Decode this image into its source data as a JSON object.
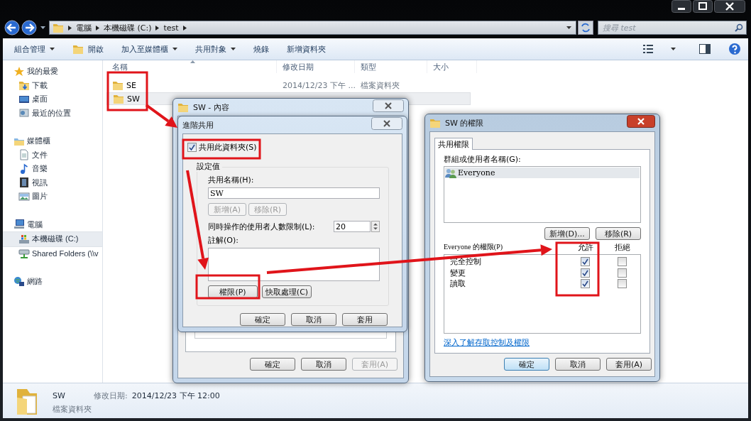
{
  "address_bar": {
    "path": [
      "電腦",
      "本機磁碟 (C:)",
      "test"
    ]
  },
  "search": {
    "placeholder": "搜尋 test"
  },
  "toolbar": [
    {
      "label": "組合管理",
      "kind": "menu"
    },
    {
      "label": "開啟",
      "kind": "open"
    },
    {
      "label": "加入至媒體櫃",
      "kind": "menu"
    },
    {
      "label": "共用對象",
      "kind": "menu"
    },
    {
      "label": "燒錄",
      "kind": "plain"
    },
    {
      "label": "新增資料夾",
      "kind": "plain"
    }
  ],
  "sidebar": [
    {
      "label": "我的最愛",
      "kind": "favorites",
      "selected": false,
      "children": [
        {
          "label": "下載",
          "kind": "download",
          "selected": false
        },
        {
          "label": "桌面",
          "kind": "desktop",
          "selected": false
        },
        {
          "label": "最近的位置",
          "kind": "recent",
          "selected": false
        }
      ]
    },
    {
      "label": "媒體櫃",
      "kind": "library",
      "selected": false,
      "children": [
        {
          "label": "文件",
          "kind": "document",
          "selected": false
        },
        {
          "label": "音樂",
          "kind": "music",
          "selected": false
        },
        {
          "label": "視訊",
          "kind": "video",
          "selected": false
        },
        {
          "label": "圖片",
          "kind": "picture",
          "selected": false
        }
      ]
    },
    {
      "label": "電腦",
      "kind": "computer",
      "selected": false,
      "children": [
        {
          "label": "本機磁碟 (C:)",
          "kind": "drive",
          "selected": true
        },
        {
          "label": "Shared Folders (\\\\v",
          "kind": "share",
          "selected": false
        }
      ]
    },
    {
      "label": "網路",
      "kind": "network",
      "selected": false
    }
  ],
  "file_list": {
    "columns": [
      "名稱",
      "修改日期",
      "類型",
      "大小"
    ],
    "rows": [
      {
        "name": "SE",
        "modified": "2014/12/23 下午 ...",
        "type": "檔案資料夾",
        "selected": false
      },
      {
        "name": "SW",
        "selected": true
      }
    ]
  },
  "status_bar": {
    "name": "SW",
    "modified_label": "修改日期:",
    "modified": "2014/12/23 下午 12:00",
    "type": "檔案資料夾"
  },
  "properties_dialog": {
    "title": "SW - 內容",
    "buttons": [
      {
        "label": "確定",
        "disabled": false
      },
      {
        "label": "取消",
        "disabled": false
      },
      {
        "label": "套用(A)",
        "disabled": true
      }
    ]
  },
  "advanced_sharing_dialog": {
    "title": "進階共用",
    "share_checkbox": {
      "label": "共用此資料夾(S)",
      "checked": true
    },
    "settings_label": "設定值",
    "share_name_label": "共用名稱(H):",
    "share_name": "SW",
    "name_buttons": [
      {
        "label": "新增(A)",
        "disabled": true
      },
      {
        "label": "移除(R)",
        "disabled": true
      }
    ],
    "user_limit_label": "同時操作的使用者人數限制(L):",
    "user_limit": "20",
    "comment_label": "註解(O):",
    "action_buttons": [
      {
        "label": "權限(P)",
        "disabled": false
      },
      {
        "label": "快取處理(C)",
        "disabled": false
      }
    ],
    "buttons": [
      {
        "label": "確定",
        "disabled": false
      },
      {
        "label": "取消",
        "disabled": false
      },
      {
        "label": "套用",
        "disabled": false
      }
    ]
  },
  "permissions_dialog": {
    "title": "SW 的權限",
    "tabs": [
      {
        "label": "共用權限",
        "selected": true
      }
    ],
    "group_label": "群組或使用者名稱(G):",
    "users": [
      {
        "name": "Everyone",
        "selected": true
      }
    ],
    "user_buttons": [
      {
        "label": "新增(D)...",
        "disabled": false
      },
      {
        "label": "移除(R)",
        "disabled": false
      }
    ],
    "permissions_label": "Everyone 的權限(P)",
    "columns": [
      "允許",
      "拒絕"
    ],
    "permissions": [
      {
        "name": "完全控制",
        "allow": true,
        "deny": false
      },
      {
        "name": "變更",
        "allow": true,
        "deny": false
      },
      {
        "name": "讀取",
        "allow": true,
        "deny": false
      }
    ],
    "link": "深入了解存取控制及權限",
    "buttons": [
      {
        "label": "確定",
        "default": true,
        "disabled": false
      },
      {
        "label": "取消",
        "default": false,
        "disabled": false
      },
      {
        "label": "套用(A)",
        "default": false,
        "disabled": false
      }
    ]
  }
}
